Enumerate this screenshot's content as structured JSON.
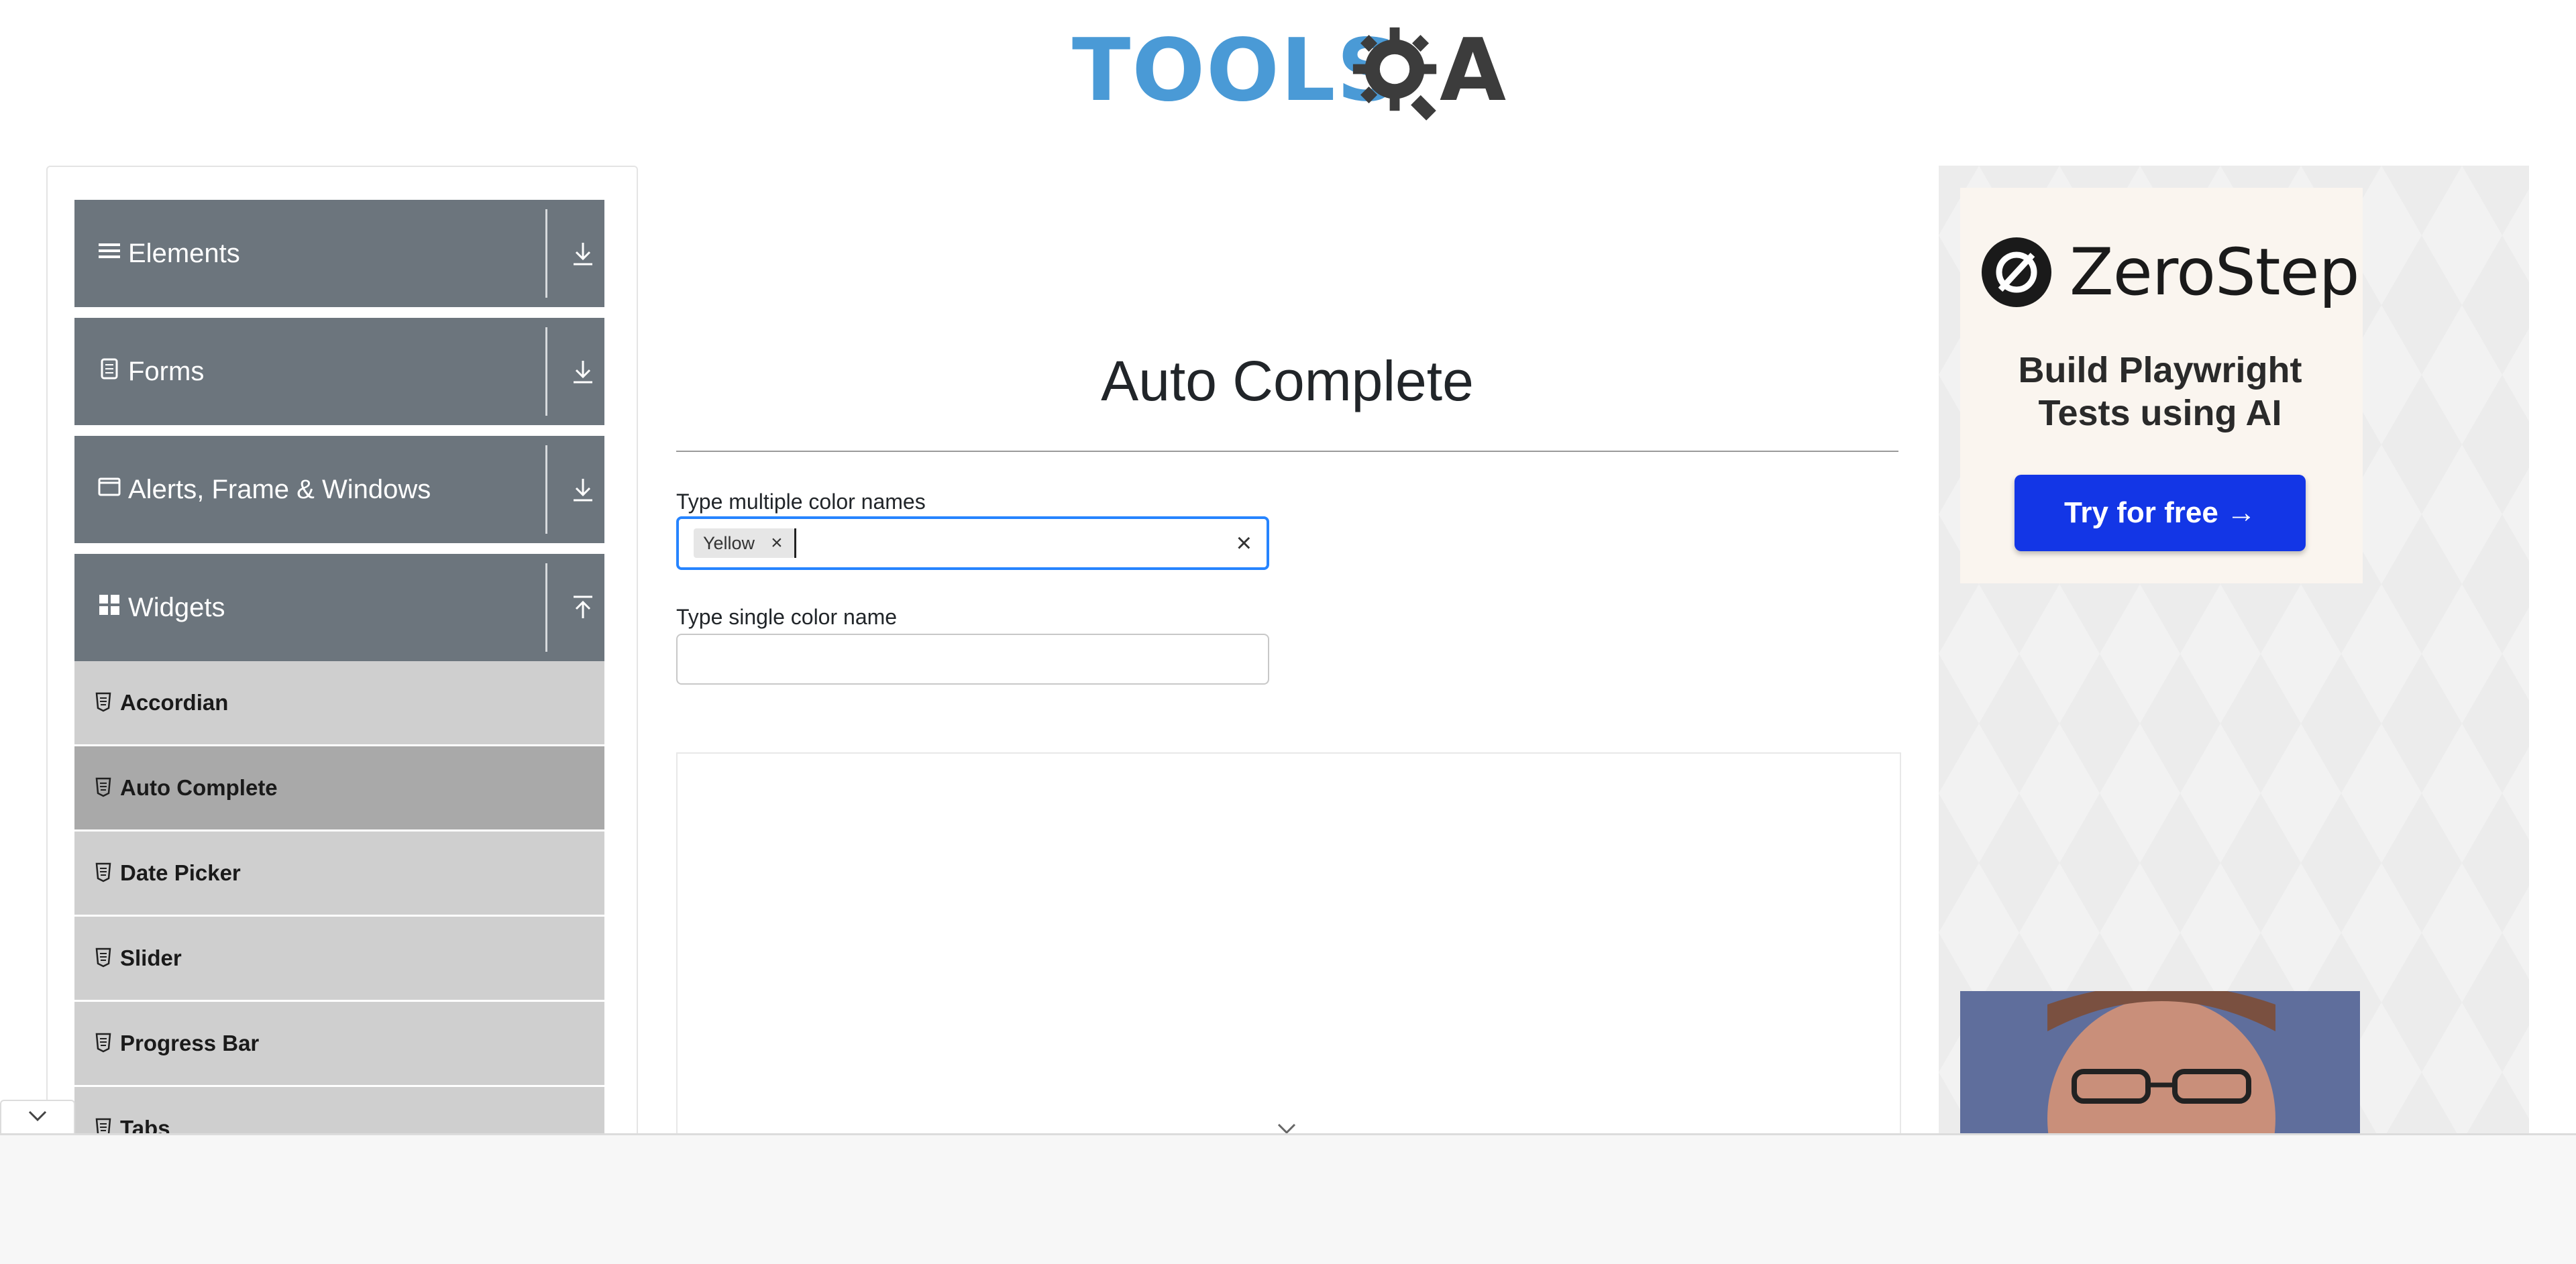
{
  "header": {
    "logo_tools": "TOOLS",
    "logo_a": "A"
  },
  "sidebar": {
    "groups": [
      {
        "label": "Elements",
        "icon": "hamburger-icon",
        "state": "collapsed"
      },
      {
        "label": "Forms",
        "icon": "form-icon",
        "state": "collapsed"
      },
      {
        "label": "Alerts, Frame & Windows",
        "icon": "window-icon",
        "state": "collapsed"
      },
      {
        "label": "Widgets",
        "icon": "grid-icon",
        "state": "expanded"
      }
    ],
    "widget_items": [
      {
        "label": "Accordian"
      },
      {
        "label": "Auto Complete",
        "active": true
      },
      {
        "label": "Date Picker"
      },
      {
        "label": "Slider"
      },
      {
        "label": "Progress Bar"
      },
      {
        "label": "Tabs"
      }
    ]
  },
  "main": {
    "title": "Auto Complete",
    "multi": {
      "label": "Type multiple color names",
      "chips": [
        "Yellow"
      ],
      "chip_remove": "×",
      "clear": "×"
    },
    "single": {
      "label": "Type single color name",
      "value": ""
    }
  },
  "ad": {
    "brand": "ZeroStep",
    "tagline_line1": "Build Playwright",
    "tagline_line2": "Tests using AI",
    "cta": "Try for free →"
  },
  "colors": {
    "sidebar_group": "#6c757d",
    "focus_border": "#2684ff",
    "cta": "#1336e6",
    "logo_blue": "#4a9ad6"
  }
}
